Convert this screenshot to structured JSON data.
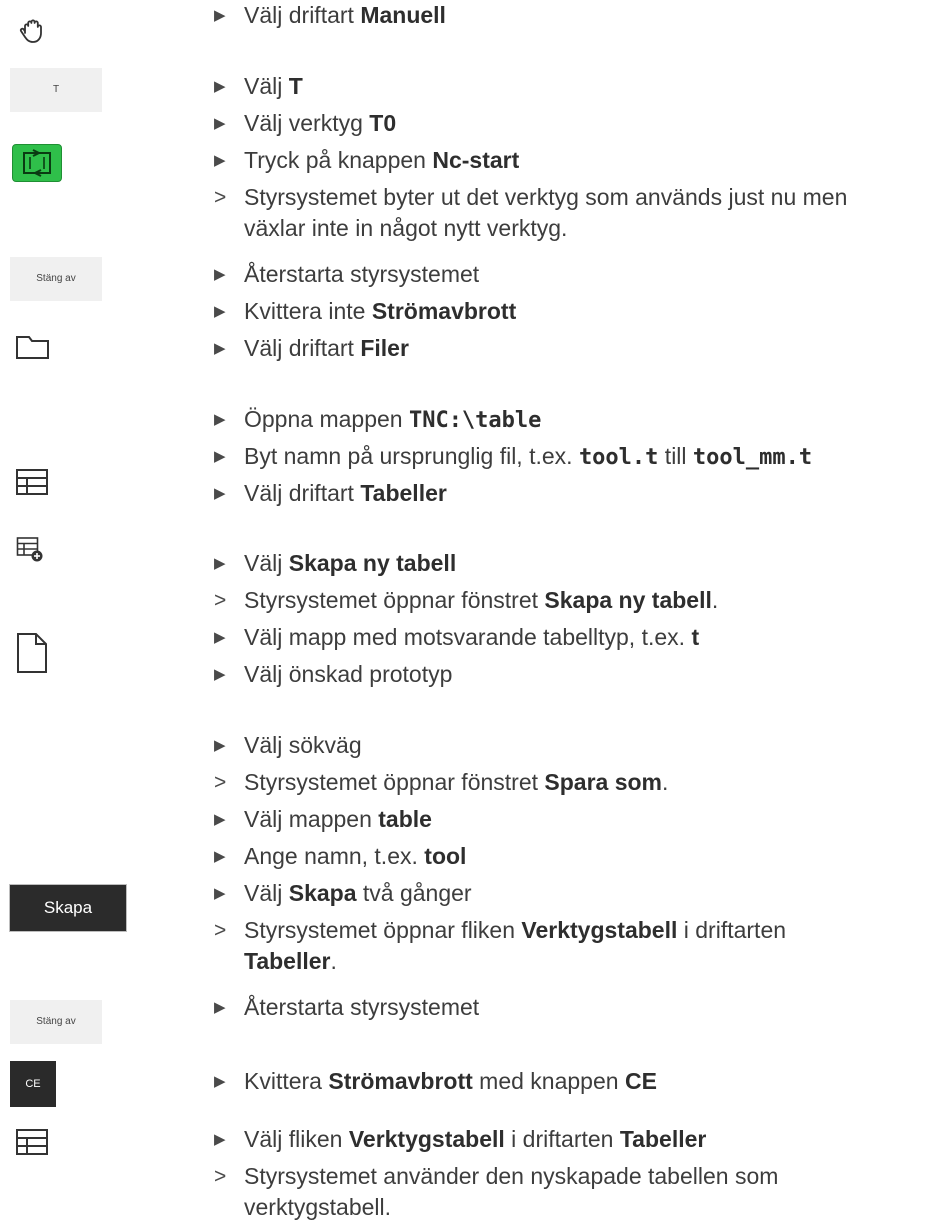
{
  "buttons": {
    "t_key": "T",
    "stang_av_1": "Stäng av",
    "skapa": "Skapa",
    "stang_av_2": "Stäng av",
    "ce": "CE"
  },
  "steps": [
    {
      "p": "Välj driftart ",
      "b": "Manuell"
    },
    {
      "p": "Välj ",
      "b": "T"
    },
    {
      "p": "Välj verktyg ",
      "b": "T0"
    },
    {
      "p": "Tryck på knappen ",
      "b": "Nc-start"
    },
    {
      "line1": "Styrsystemet byter ut det verktyg som används just nu men",
      "line2": "växlar inte in något nytt verktyg."
    },
    {
      "p": "Återstarta styrsystemet"
    },
    {
      "p": "Kvittera inte ",
      "b": "Strömavbrott"
    },
    {
      "p": "Välj driftart ",
      "b": "Filer"
    },
    {
      "p": "Öppna mappen ",
      "b": "TNC:\\table"
    },
    {
      "p": "Byt namn på ursprunglig fil, t.ex. ",
      "b": "tool.t",
      "m": " till ",
      "b2": "tool_mm.t"
    },
    {
      "p": "Välj driftart ",
      "b": "Tabeller"
    },
    {
      "p": "Välj ",
      "b": "Skapa ny tabell"
    },
    {
      "p": "Styrsystemet öppnar fönstret ",
      "b": "Skapa ny tabell",
      "s": "."
    },
    {
      "p": "Välj mapp med motsvarande tabelltyp, t.ex. ",
      "b": "t"
    },
    {
      "p": "Välj önskad prototyp"
    },
    {
      "p": "Välj sökväg"
    },
    {
      "p": "Styrsystemet öppnar fönstret ",
      "b": "Spara som",
      "s": "."
    },
    {
      "p": "Välj mappen ",
      "b": "table"
    },
    {
      "p": "Ange namn, t.ex. ",
      "b": "tool"
    },
    {
      "p": "Välj ",
      "b": "Skapa",
      "s": " två gånger"
    },
    {
      "p": "Styrsystemet öppnar fliken ",
      "b": "Verktygstabell",
      "s": " i driftarten",
      "b2": "Tabeller",
      "s2": "."
    },
    {
      "p": "Återstarta styrsystemet"
    },
    {
      "p": "Kvittera ",
      "b": "Strömavbrott",
      "m": " med knappen ",
      "b2": "CE"
    },
    {
      "p": "Välj fliken ",
      "b": "Verktygstabell",
      "m": " i driftarten ",
      "b2": "Tabeller"
    },
    {
      "line1": "Styrsystemet använder den nyskapade tabellen som",
      "line2": "verktygstabell."
    }
  ],
  "icons": [
    "hand-icon",
    "nc-start-icon",
    "folder-icon",
    "table-icon",
    "new-table-icon",
    "document-icon",
    "table-icon"
  ]
}
